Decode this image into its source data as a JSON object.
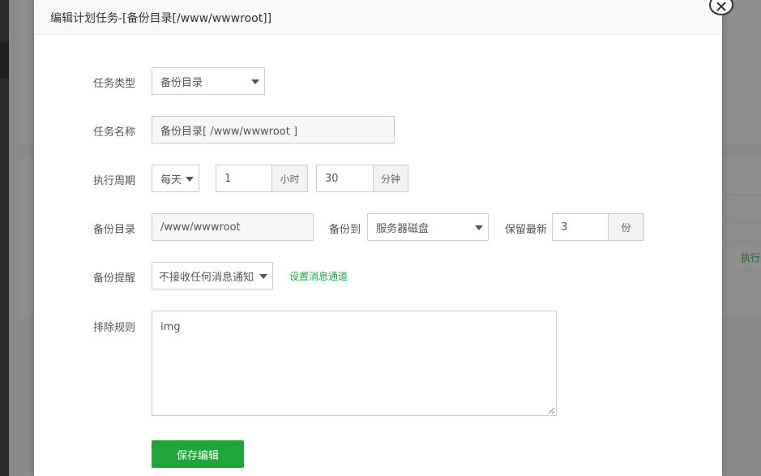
{
  "background": {
    "exec_link": "执行"
  },
  "modal": {
    "title": "编辑计划任务-[备份目录[/www/wwwroot]]",
    "close_icon": "close-icon"
  },
  "form": {
    "task_type": {
      "label": "任务类型",
      "value": "备份目录"
    },
    "task_name": {
      "label": "任务名称",
      "value": "备份目录[ /www/wwwroot ]"
    },
    "cycle": {
      "label": "执行周期",
      "period": "每天",
      "hour_value": "1",
      "hour_unit": "小时",
      "minute_value": "30",
      "minute_unit": "分钟"
    },
    "backup_dir": {
      "label": "备份目录",
      "value": "/www/wwwroot",
      "backup_to_label": "备份到",
      "backup_to_value": "服务器磁盘",
      "keep_latest_label": "保留最新",
      "keep_latest_value": "3",
      "keep_unit": "份"
    },
    "notify": {
      "label": "备份提醒",
      "value": "不接收任何消息通知",
      "link": "设置消息通道"
    },
    "exclude": {
      "label": "排除规则",
      "value": "img"
    },
    "save_label": "保存编辑"
  },
  "colors": {
    "accent": "#20a53a"
  }
}
